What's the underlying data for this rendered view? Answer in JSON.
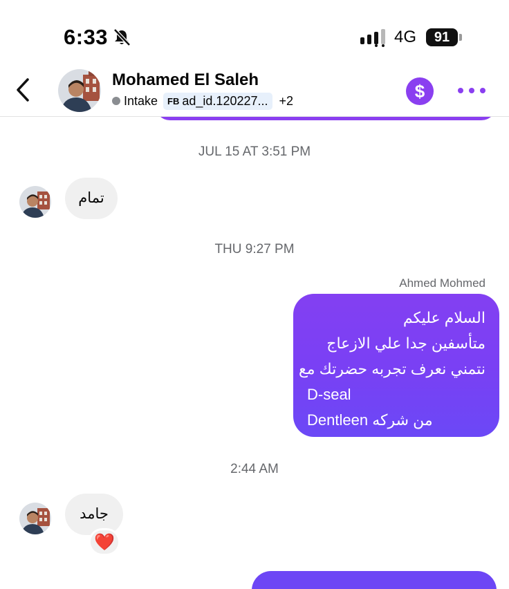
{
  "status_bar": {
    "time": "6:33",
    "network": "4G",
    "battery": "91"
  },
  "header": {
    "contact_name": "Mohamed El Saleh",
    "stage_tag": "Intake",
    "ad_tag_prefix": "FB",
    "ad_tag": "ad_id.120227...",
    "more_tags": "+2",
    "dollar_symbol": "$",
    "accent_color": "#8a3ff0"
  },
  "messages": {
    "ts1": "JUL 15 AT 3:51 PM",
    "msg1": "تمام",
    "ts2": "THU 9:27 PM",
    "sender": "Ahmed Mohmed",
    "out_lines": [
      "السلام عليكم",
      "متأسفين جدا علي الازعاج",
      "نتمني نعرف تجربه حضرتك مع",
      "D-seal",
      "Dentleen من شركه"
    ],
    "ts3": "2:44 AM",
    "msg3": "جامد",
    "reaction": "❤️"
  },
  "icons": [
    "back-chevron-icon",
    "bell-off-icon",
    "signal-bars-icon",
    "dollar-icon",
    "more-dots-icon",
    "heart-icon"
  ]
}
